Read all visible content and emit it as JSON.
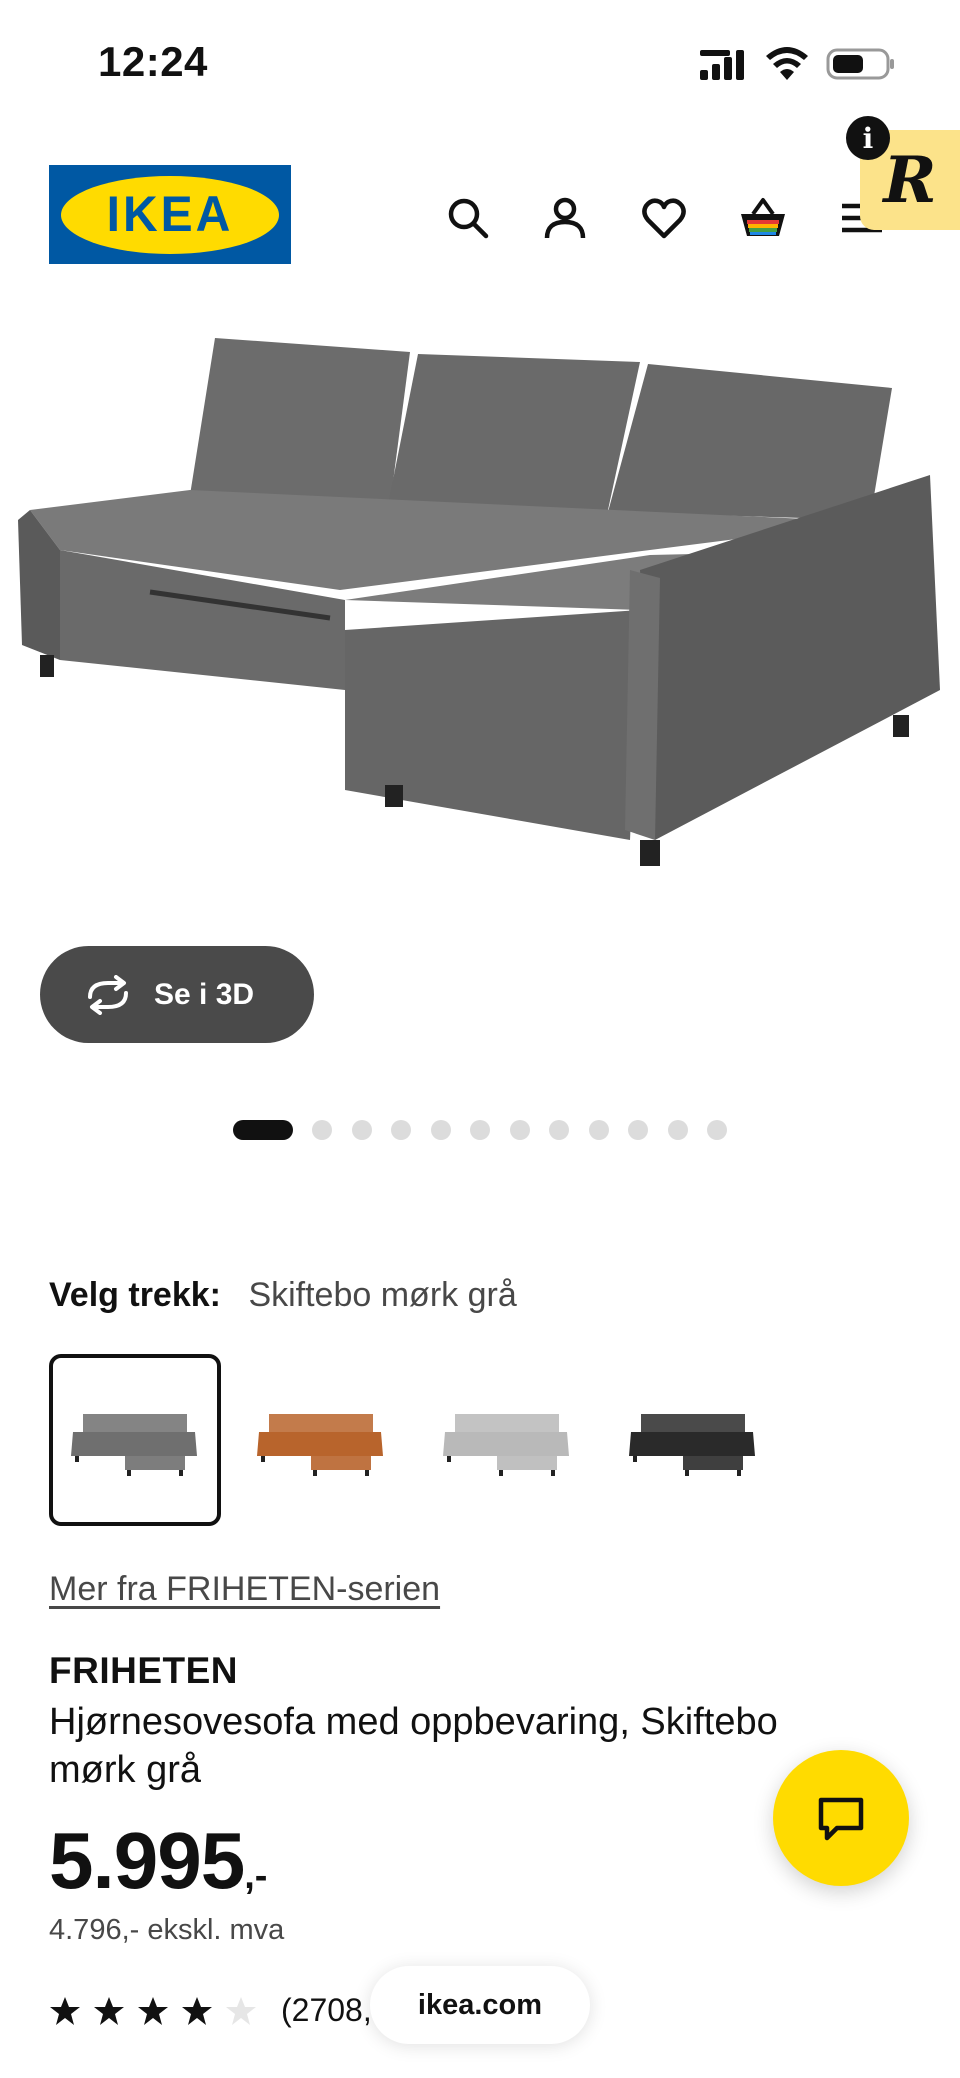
{
  "status_bar": {
    "time": "12:24"
  },
  "header": {
    "logo_text": "IKEA",
    "icons": [
      "search-icon",
      "profile-icon",
      "heart-icon",
      "basket-icon",
      "menu-icon"
    ],
    "extension": {
      "letter": "R",
      "info": "i"
    }
  },
  "gallery": {
    "view_3d_label": "Se i 3D",
    "image_count": 12,
    "active_index": 0
  },
  "cover": {
    "label": "Velg trekk:",
    "value": "Skiftebo mørk grå",
    "swatches": [
      {
        "name": "Skiftebo mørk grå",
        "color": "#6f6f6f",
        "selected": true
      },
      {
        "name": "Skiftebo oransje",
        "color": "#b8642c",
        "selected": false
      },
      {
        "name": "Skiftebo lys grå",
        "color": "#b9b9b9",
        "selected": false
      },
      {
        "name": "Svart",
        "color": "#2a2a2a",
        "selected": false
      }
    ]
  },
  "product": {
    "series_link": "Mer fra FRIHETEN-serien",
    "name": "FRIHETEN",
    "description": "Hjørnesovesofa med oppbevaring, Skiftebo mørk grå",
    "price_main": "5.995",
    "price_suffix": ",-",
    "price_ex_vat": "4.796,- ekskl. mva",
    "rating": 4,
    "rating_max": 5,
    "review_count": "(2708,"
  },
  "browser": {
    "url": "ikea.com"
  },
  "colors": {
    "ikea_blue": "#0058a3",
    "ikea_yellow": "#ffdb00",
    "dark_button": "#4a4a4a"
  }
}
